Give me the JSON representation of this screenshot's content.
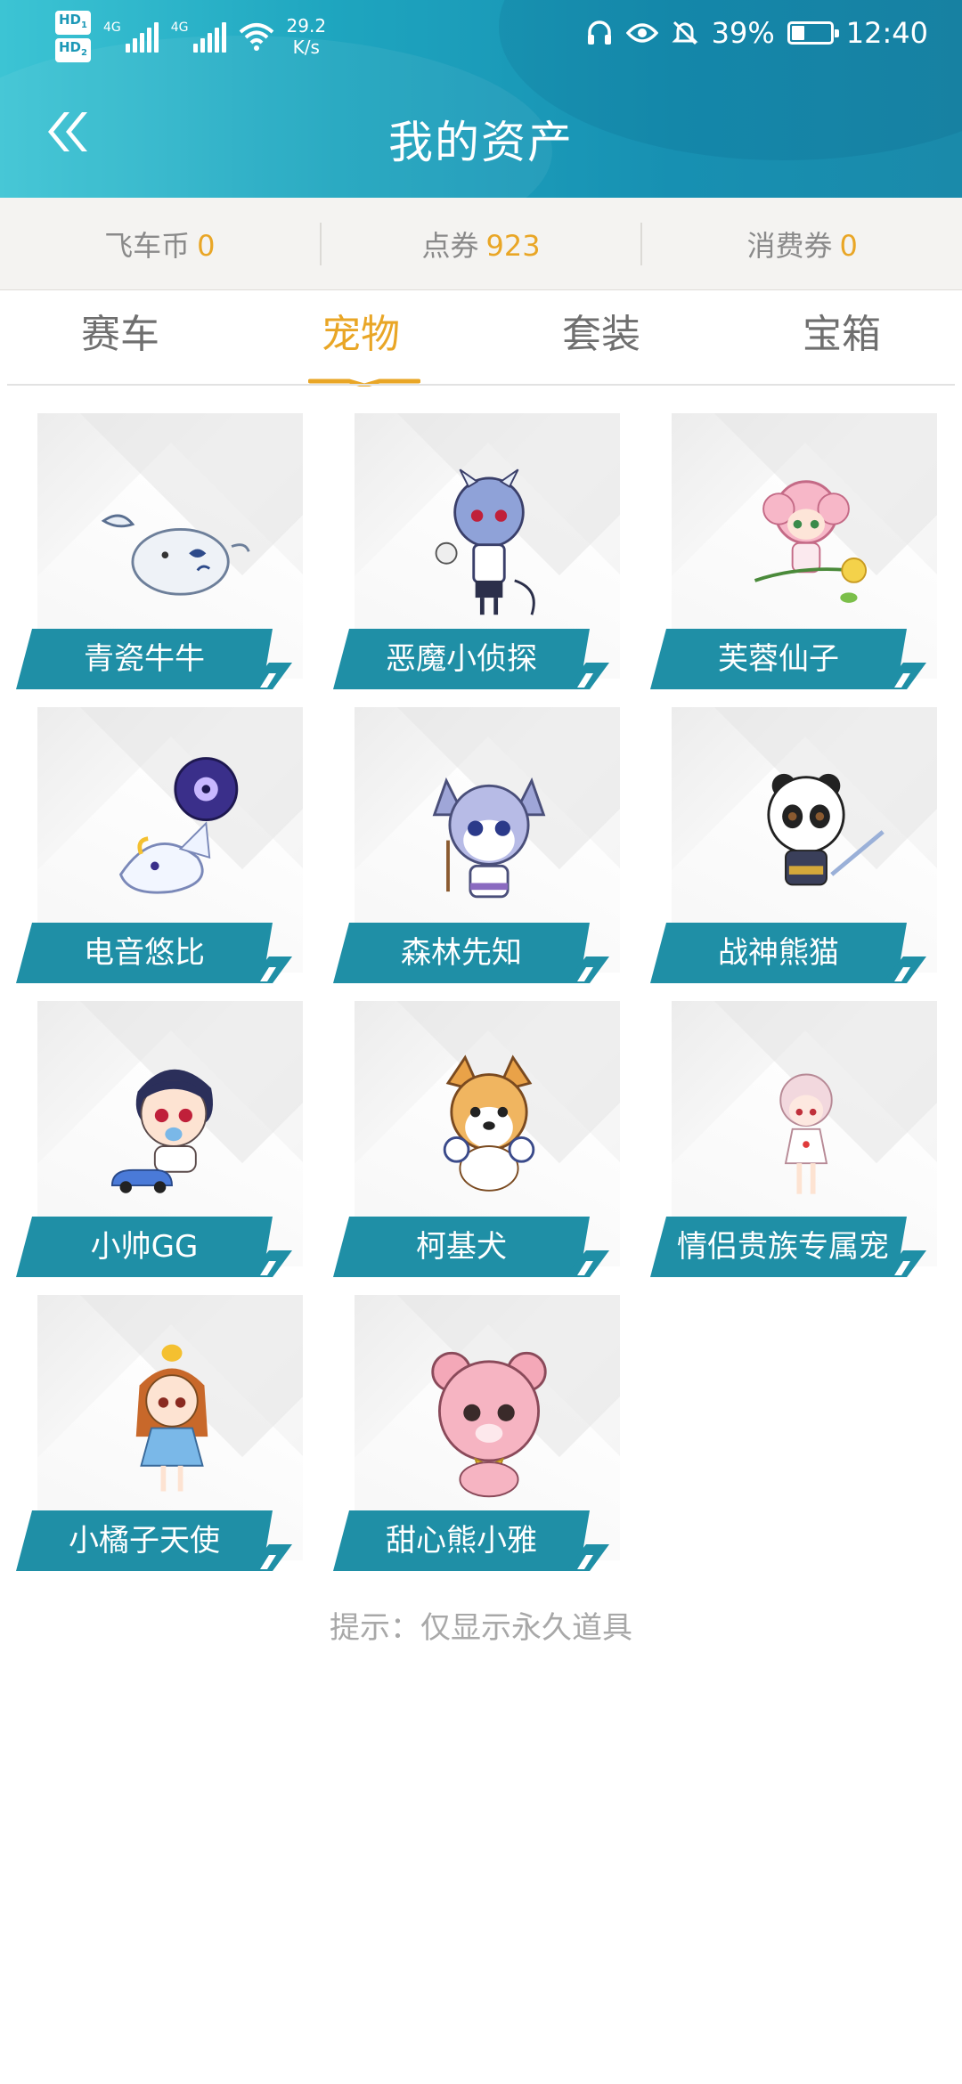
{
  "status_bar": {
    "hd1": "HD",
    "hd1_sub": "1",
    "hd2": "HD",
    "hd2_sub": "2",
    "signal1_label": "4G",
    "signal2_label": "4G",
    "speed_value": "29.2",
    "speed_unit": "K/s",
    "battery_percent": "39%",
    "time": "12:40"
  },
  "header": {
    "title": "我的资产"
  },
  "currency": [
    {
      "label": "飞车币",
      "value": "0"
    },
    {
      "label": "点券",
      "value": "923"
    },
    {
      "label": "消费券",
      "value": "0"
    }
  ],
  "tabs": [
    {
      "label": "赛车",
      "active": false
    },
    {
      "label": "宠物",
      "active": true
    },
    {
      "label": "套装",
      "active": false
    },
    {
      "label": "宝箱",
      "active": false
    }
  ],
  "pets": [
    {
      "name": "青瓷牛牛",
      "icon": "porcelain-cow-pet-icon"
    },
    {
      "name": "恶魔小侦探",
      "icon": "devil-detective-pet-icon"
    },
    {
      "name": "芙蓉仙子",
      "icon": "lotus-fairy-pet-icon"
    },
    {
      "name": "电音悠比",
      "icon": "electro-yubi-pet-icon"
    },
    {
      "name": "森林先知",
      "icon": "forest-prophet-pet-icon"
    },
    {
      "name": "战神熊猫",
      "icon": "war-panda-pet-icon"
    },
    {
      "name": "小帅GG",
      "icon": "handsome-boy-pet-icon"
    },
    {
      "name": "柯基犬",
      "icon": "corgi-pet-icon"
    },
    {
      "name": "情侣贵族专属宠",
      "icon": "couple-noble-pet-icon"
    },
    {
      "name": "小橘子天使",
      "icon": "orange-angel-pet-icon"
    },
    {
      "name": "甜心熊小雅",
      "icon": "sweet-bear-pet-icon"
    }
  ],
  "hint": "提示：仅显示永久道具",
  "colors": {
    "accent": "#e9a626",
    "header": "#1ea5bf",
    "label_bg": "#1f8fa6"
  }
}
